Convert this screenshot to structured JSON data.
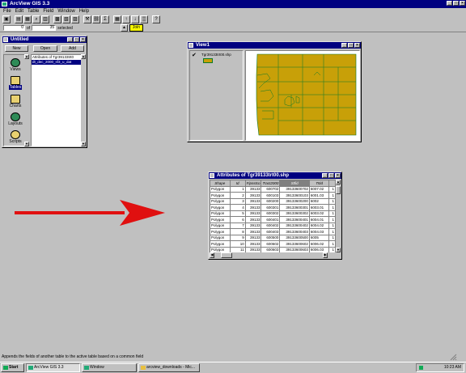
{
  "app": {
    "title": "ArcView GIS 3.3",
    "menus": [
      "File",
      "Edit",
      "Table",
      "Field",
      "Window",
      "Help"
    ],
    "toolbar_icons": [
      "save-icon",
      "add-table-icon",
      "properties-icon",
      "find-icon",
      "query-icon",
      "promote-icon",
      "select-all-icon",
      "select-none-icon",
      "join-icon",
      "link-icon",
      "statistics-icon",
      "summarize-icon",
      "sort-ascending-icon",
      "sort-descending-icon",
      "calculate-icon",
      "help-icon"
    ],
    "tools": {
      "pointer": "▲",
      "join_label": "Join"
    }
  },
  "status": {
    "selected_count": "0",
    "of_label": "of",
    "total_count": "35",
    "selected_label": "selected"
  },
  "project": {
    "title": "Untitled",
    "buttons": {
      "new": "New",
      "open": "Open",
      "add": "Add"
    },
    "doc_types": [
      {
        "label": "Views",
        "icon": "views-icon"
      },
      {
        "label": "Tables",
        "icon": "tables-icon"
      },
      {
        "label": "Charts",
        "icon": "charts-icon"
      },
      {
        "label": "Layouts",
        "icon": "layouts-icon"
      },
      {
        "label": "Scripts",
        "icon": "scripts-icon"
      }
    ],
    "selected_doc_type": "Tables",
    "list_items": [
      "Attributes of Tgr39133trt0",
      "dt_dec_2000_sf3_u_dat"
    ]
  },
  "view": {
    "title": "View1",
    "layer": "Tgr39133trt00.shp",
    "layer_checked": true,
    "fill_color": "#c8a008",
    "outline_color": "#0a7a2a"
  },
  "attr_table": {
    "title": "Attributes of Tgr39133trt00.shp",
    "columns": [
      "Shape",
      "Id",
      "Fipsstco",
      "Tract2000",
      "Stfid",
      "Trtid"
    ],
    "rows": [
      [
        "Polygon",
        "1",
        "39133",
        "600702",
        "39133600702",
        "6007.02"
      ],
      [
        "Polygon",
        "2",
        "39133",
        "600103",
        "39133600103",
        "6001.03"
      ],
      [
        "Polygon",
        "3",
        "39133",
        "600200",
        "39133600200",
        "6002"
      ],
      [
        "Polygon",
        "4",
        "39133",
        "600301",
        "39133600301",
        "6003.01"
      ],
      [
        "Polygon",
        "5",
        "39133",
        "600302",
        "39133600302",
        "6003.02"
      ],
      [
        "Polygon",
        "6",
        "39133",
        "600401",
        "39133600401",
        "6004.01"
      ],
      [
        "Polygon",
        "7",
        "39133",
        "600402",
        "39133600402",
        "6004.02"
      ],
      [
        "Polygon",
        "8",
        "39133",
        "600403",
        "39133600403",
        "6004.03"
      ],
      [
        "Polygon",
        "9",
        "39133",
        "600500",
        "39133600500",
        "6005"
      ],
      [
        "Polygon",
        "10",
        "39133",
        "600602",
        "39133600602",
        "6006.02"
      ],
      [
        "Polygon",
        "11",
        "39133",
        "600603",
        "39133600603",
        "6006.03"
      ]
    ],
    "selected_column": "Stfid",
    "last_col_value": "1"
  },
  "hint": "Appends the fields of another table to the active table based on a common field",
  "taskbar": {
    "start": "Start",
    "items": [
      "ArcView GIS 3.3",
      "Window",
      "arcview_downloads - Mic..."
    ],
    "clock": "10:23 AM"
  },
  "colors": {
    "arrow": "#e01010",
    "titlebar": "#000080"
  }
}
